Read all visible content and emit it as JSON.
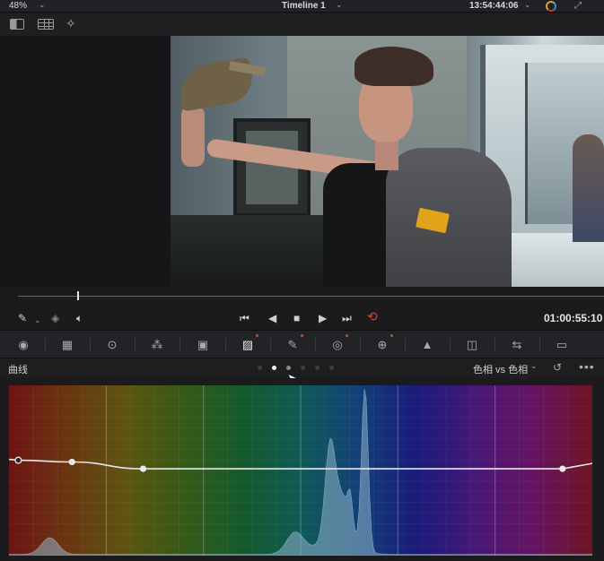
{
  "topbar": {
    "zoom": "48%",
    "timeline_title": "Timeline 1",
    "timecode": "13:54:44:06"
  },
  "transport": {
    "timecode": "01:00:55:10"
  },
  "scrubber": {
    "playhead_fraction": 0.145
  },
  "curves": {
    "title": "曲线",
    "mode_label": "色相 vs 色相",
    "page_dots": {
      "count": 6,
      "active_index": 1
    }
  },
  "colors": {
    "loop_active": "#e5432c",
    "modified_dot": "#e0452f",
    "curve_line": "#e8e8e8",
    "histogram_fill": "#8fb3c8"
  },
  "icons": {
    "topbar": [
      "chevron-down-icon",
      "chevron-down-icon",
      "chevron-down-icon",
      "color-wheel-icon",
      "expand-icon"
    ],
    "viewer_toolbar": [
      "split-view-icon",
      "grid-view-icon",
      "magic-wand-icon"
    ],
    "transport": [
      "eyedropper-icon",
      "layers-icon",
      "speaker-icon",
      "skip-start-icon",
      "step-back-icon",
      "stop-icon",
      "play-icon",
      "skip-end-icon",
      "loop-icon"
    ],
    "palette": [
      "camera-raw-icon",
      "color-match-icon",
      "color-wheels-icon",
      "rgb-mixer-icon",
      "motion-effects-icon",
      "curves-icon",
      "qualifier-icon",
      "window-icon",
      "tracker-icon",
      "blur-icon",
      "key-icon",
      "sizing-icon",
      "3d-icon"
    ]
  },
  "hue_curve": {
    "control_points": [
      [
        0.016,
        0.44
      ],
      [
        0.108,
        0.45
      ],
      [
        0.23,
        0.49
      ],
      [
        0.949,
        0.49
      ]
    ],
    "histogram_peaks": [
      [
        0.07,
        0.1
      ],
      [
        0.49,
        0.12
      ],
      [
        0.55,
        0.52
      ],
      [
        0.57,
        0.3
      ],
      [
        0.61,
        1.0
      ]
    ]
  }
}
